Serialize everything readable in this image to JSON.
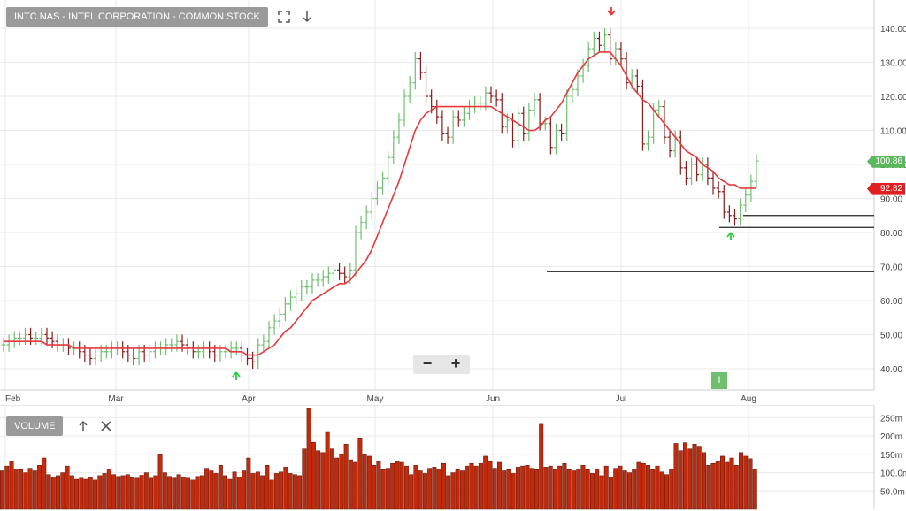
{
  "header": {
    "title": "INTC.NAS - INTEL CORPORATION - COMMON STOCK"
  },
  "toolbar": {
    "expand_icon": "expand-icon",
    "download_icon": "download-arrow-icon"
  },
  "zoom": {
    "minus_label": "−",
    "plus_label": "+"
  },
  "info_badge": {
    "label": "I"
  },
  "volume_panel": {
    "label": "VOLUME",
    "up_icon": "arrow-up-icon",
    "close_icon": "close-icon"
  },
  "price_tags": {
    "current": "100.86",
    "moving_average": "92.82",
    "current_color": "#5cb85c",
    "ma_color": "#e02020"
  },
  "colors": {
    "up_bar": "#6fbf6f",
    "down_bar": "#8b1a1a",
    "ma_line": "#e8393c",
    "volume_bar": "#c12a0c",
    "sell_arrow": "#e8393c",
    "buy_arrow": "#2ecc40"
  },
  "chart_data": [
    {
      "type": "line",
      "title": "",
      "subtitle": "",
      "series_type": "ohlc",
      "x_labels": [
        "Feb",
        "Mar",
        "Apr",
        "May",
        "Jun",
        "Jul",
        "Aug"
      ],
      "y_ticks": [
        "40.00",
        "50.00",
        "60.00",
        "70.00",
        "80.00",
        "90.00",
        "100.00",
        "110.00",
        "120.00",
        "130.00",
        "140.00"
      ],
      "ylim": [
        33,
        148
      ],
      "grid": true,
      "ohlc_closes": [
        47,
        48,
        49,
        49,
        50,
        49,
        49,
        50,
        49,
        48,
        47,
        47,
        46,
        46,
        45,
        44,
        43,
        44,
        45,
        45,
        46,
        46,
        45,
        44,
        43,
        45,
        44,
        45,
        46,
        46,
        47,
        47,
        48,
        47,
        46,
        45,
        45,
        46,
        45,
        44,
        45,
        45,
        46,
        46,
        44,
        43,
        42,
        47,
        48,
        52,
        54,
        56,
        59,
        61,
        62,
        64,
        64,
        66,
        66,
        67,
        68,
        69,
        68,
        67,
        69,
        80,
        83,
        86,
        90,
        93,
        96,
        102,
        108,
        113,
        120,
        124,
        131,
        127,
        120,
        117,
        114,
        109,
        108,
        114,
        113,
        115,
        117,
        118,
        118,
        121,
        120,
        119,
        111,
        113,
        107,
        115,
        109,
        116,
        119,
        112,
        112,
        105,
        110,
        109,
        120,
        122,
        126,
        129,
        134,
        137,
        135,
        138,
        131,
        134,
        131,
        124,
        126,
        123,
        106,
        108,
        116,
        117,
        108,
        104,
        108,
        99,
        96,
        100,
        97,
        100,
        96,
        93,
        92,
        86,
        85,
        84,
        88,
        91,
        95,
        101
      ],
      "moving_average": [
        48,
        48,
        48,
        48,
        48,
        48,
        48,
        48,
        47,
        47,
        47,
        47,
        47,
        46,
        46,
        46,
        46,
        46,
        46,
        46,
        46,
        46,
        46,
        46,
        46,
        46,
        46,
        46,
        46,
        46,
        46,
        46,
        46,
        46,
        46,
        46,
        46,
        46,
        46,
        46,
        46,
        46,
        45,
        45,
        45,
        44,
        44,
        44,
        45,
        46,
        47,
        49,
        51,
        52,
        54,
        56,
        58,
        60,
        61,
        62,
        63,
        64,
        65,
        65,
        66,
        68,
        70,
        72,
        75,
        79,
        83,
        87,
        91,
        95,
        100,
        105,
        110,
        113,
        115,
        116,
        117,
        117,
        117,
        117,
        117,
        117,
        117,
        117,
        117,
        117,
        117,
        116,
        115,
        114,
        113,
        112,
        111,
        110,
        110,
        111,
        113,
        114,
        116,
        118,
        121,
        124,
        127,
        129,
        131,
        132,
        133,
        133,
        133,
        131,
        129,
        126,
        123,
        121,
        119,
        118,
        116,
        114,
        112,
        110,
        108,
        106,
        104,
        103,
        102,
        100,
        99,
        98,
        96,
        95,
        94,
        94,
        93,
        93,
        93,
        93
      ],
      "horizontal_levels": [
        68.5,
        81.5,
        85
      ],
      "markers": [
        {
          "type": "buy",
          "month": "Apr"
        },
        {
          "type": "sell",
          "month": "Jul"
        },
        {
          "type": "buy",
          "month": "Aug"
        }
      ]
    },
    {
      "type": "bar",
      "title": "VOLUME",
      "y_ticks": [
        "50.0m",
        "100.0m",
        "150m",
        "200m",
        "250m"
      ],
      "ylim": [
        0,
        280
      ],
      "volumes_millions": [
        105,
        118,
        132,
        110,
        108,
        100,
        112,
        105,
        120,
        140,
        95,
        88,
        92,
        100,
        118,
        92,
        82,
        85,
        82,
        88,
        80,
        92,
        98,
        110,
        95,
        90,
        92,
        95,
        88,
        85,
        93,
        100,
        85,
        92,
        150,
        100,
        90,
        85,
        95,
        88,
        85,
        80,
        90,
        92,
        112,
        105,
        98,
        120,
        92,
        82,
        102,
        88,
        105,
        140,
        98,
        102,
        92,
        120,
        80,
        98,
        102,
        115,
        98,
        95,
        92,
        165,
        275,
        183,
        160,
        155,
        210,
        165,
        140,
        150,
        178,
        135,
        128,
        195,
        150,
        145,
        120,
        130,
        108,
        112,
        125,
        130,
        128,
        118,
        95,
        120,
        105,
        98,
        112,
        115,
        110,
        125,
        92,
        100,
        108,
        105,
        118,
        125,
        118,
        125,
        145,
        130,
        112,
        128,
        105,
        108,
        98,
        115,
        118,
        120,
        112,
        108,
        232,
        115,
        118,
        110,
        118,
        125,
        108,
        105,
        110,
        120,
        108,
        98,
        110,
        92,
        118,
        88,
        112,
        118,
        105,
        100,
        110,
        128,
        125,
        120,
        108,
        118,
        102,
        95,
        110,
        180,
        160,
        182,
        165,
        178,
        170,
        155,
        120,
        125,
        132,
        145,
        128,
        140,
        120,
        155,
        145,
        138,
        110
      ]
    }
  ]
}
